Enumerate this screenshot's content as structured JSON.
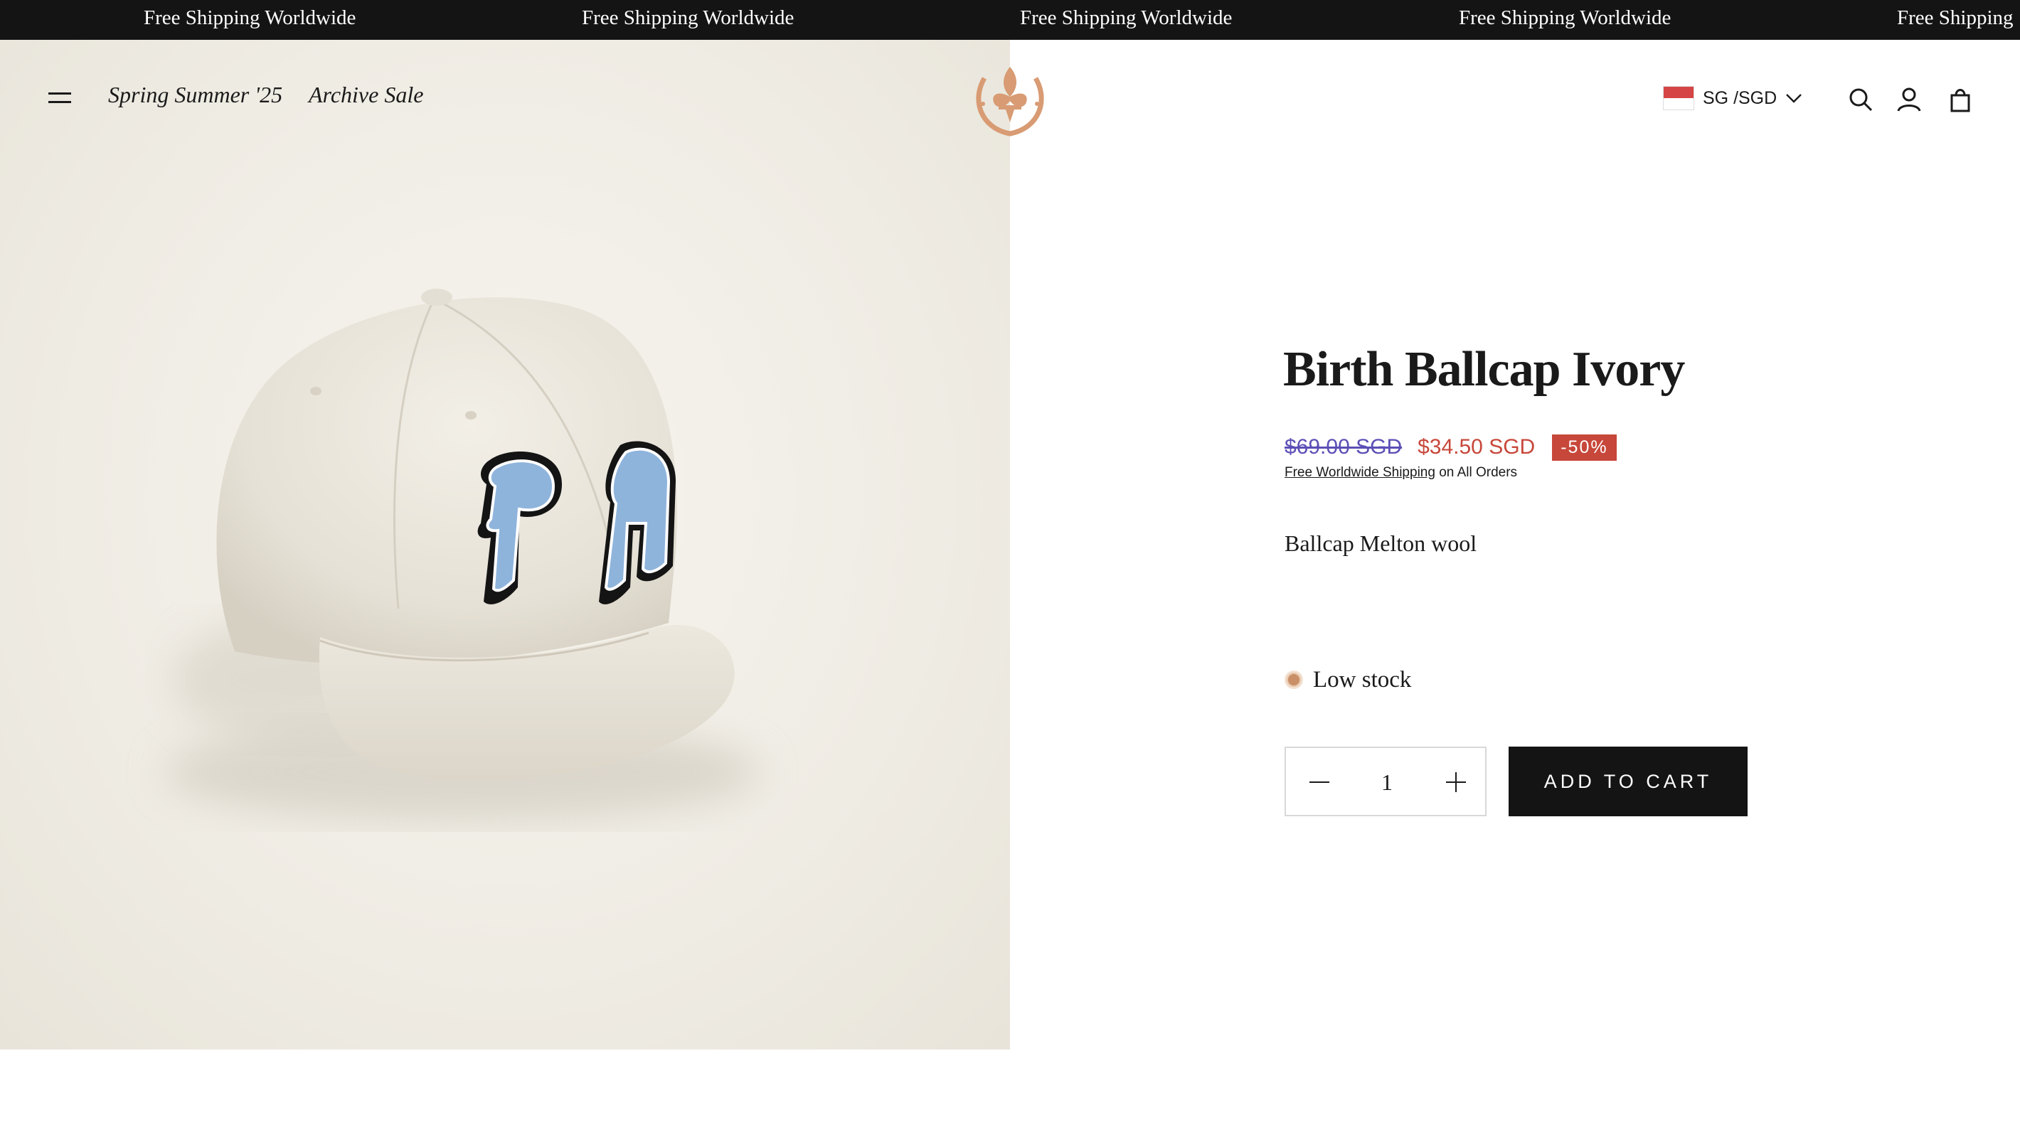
{
  "announcement": {
    "items": [
      "Free Shipping Worldwide",
      "Free Shipping Worldwide",
      "Free Shipping Worldwide",
      "Free Shipping Worldwide",
      "Free Shipping"
    ]
  },
  "header": {
    "nav": [
      "Spring Summer '25",
      "Archive Sale"
    ],
    "country_selector": "SG /SGD",
    "logo_color": "#d89b73"
  },
  "product": {
    "title": "Birth Ballcap Ivory",
    "compare_price": "$69.00 SGD",
    "sale_price": "$34.50 SGD",
    "discount_badge": "-50%",
    "shipping_link": "Free Worldwide Shipping",
    "shipping_suffix": "on All Orders",
    "description": "Ballcap Melton wool",
    "stock_status": "Low stock",
    "quantity": "1",
    "add_to_cart": "ADD TO CART",
    "image_monogram": "PH",
    "monogram_color": "#8fb4dc"
  },
  "colors": {
    "announcement_bg": "#141414",
    "sale_red": "#c7473a",
    "compare_price": "#5b4fb5",
    "button_bg": "#141414"
  }
}
